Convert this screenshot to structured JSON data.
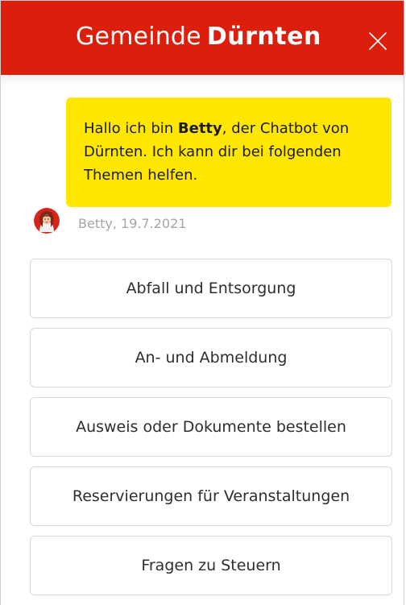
{
  "header": {
    "brand_light": "Gemeinde",
    "brand_bold": "Dürnten",
    "background_color": "#dc1f0d",
    "close_icon": "close-icon"
  },
  "chat": {
    "message": {
      "text_before": "Hallo ich bin ",
      "bot_name": "Betty",
      "text_after": ", der Chatbot von Dürnten. Ich kann dir bei folgenden Themen helfen.",
      "bubble_color": "#ffe700"
    },
    "sender_meta": "Betty, 19.7.2021",
    "avatar_icon": "betty-avatar-icon"
  },
  "options": [
    {
      "label": "Abfall und Entsorgung"
    },
    {
      "label": "An- und Abmeldung"
    },
    {
      "label": "Ausweis oder Dokumente bestellen"
    },
    {
      "label": "Reservierungen für Veranstaltungen"
    },
    {
      "label": "Fragen zu Steuern"
    }
  ]
}
